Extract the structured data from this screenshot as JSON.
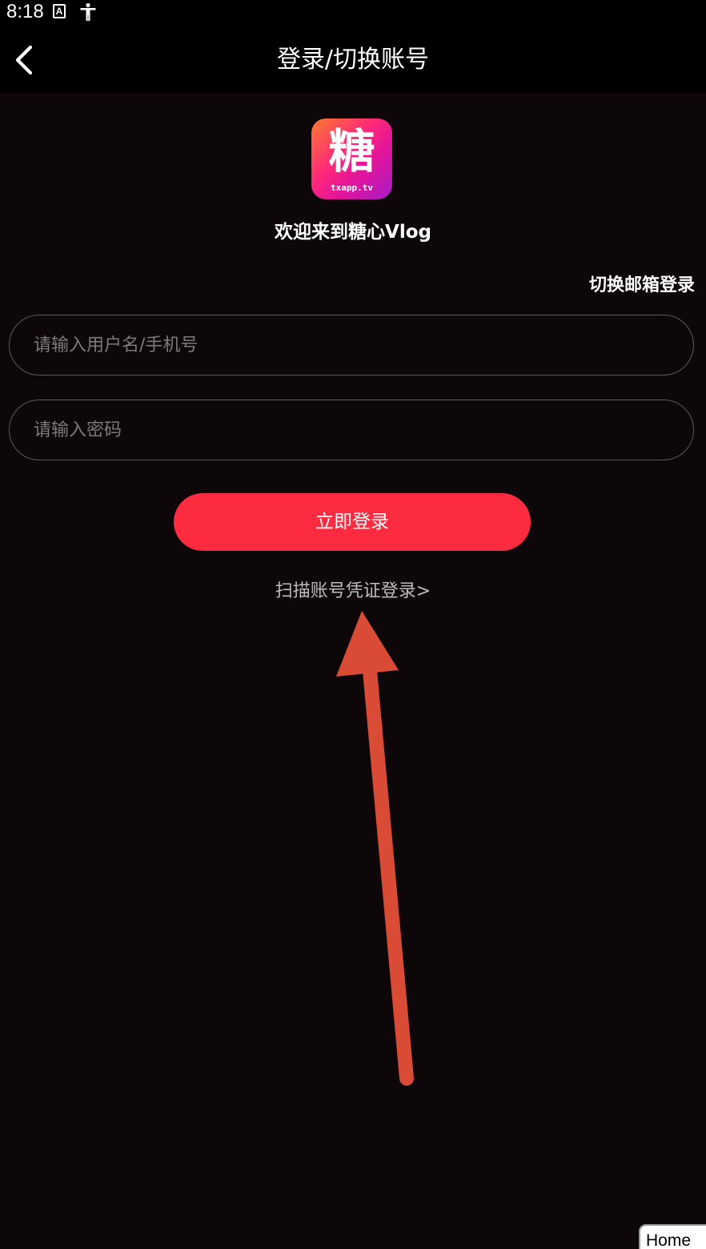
{
  "status_bar": {
    "time": "8:18",
    "icons": [
      "text-badge-icon",
      "accessibility-icon"
    ]
  },
  "header": {
    "title": "登录/切换账号",
    "back_icon": "chevron-left-icon"
  },
  "logo": {
    "glyph": "糖",
    "subtext": "txapp.tv"
  },
  "welcome_text": "欢迎来到糖心Vlog",
  "switch_email_label": "切换邮箱登录",
  "form": {
    "username_placeholder": "请输入用户名/手机号",
    "password_placeholder": "请输入密码",
    "login_button_label": "立即登录",
    "scan_login_label": "扫描账号凭证登录>"
  },
  "annotation": {
    "type": "arrow",
    "color": "#d94b35",
    "points_to": "scan-login-link"
  },
  "home_button_label": "Home",
  "colors": {
    "background": "#0d0709",
    "header": "#000000",
    "accent": "#fd2b40",
    "input_border": "#5a5a5a",
    "placeholder": "#7b7b7b"
  }
}
